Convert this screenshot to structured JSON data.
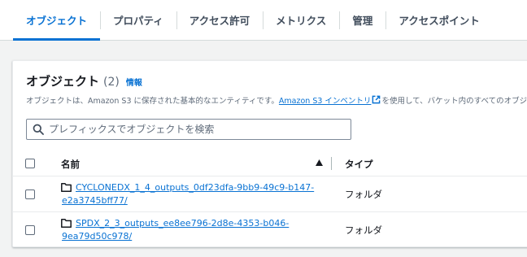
{
  "tabs": [
    {
      "label": "オブジェクト",
      "active": true
    },
    {
      "label": "プロパティ"
    },
    {
      "label": "アクセス許可"
    },
    {
      "label": "メトリクス"
    },
    {
      "label": "管理"
    },
    {
      "label": "アクセスポイント"
    }
  ],
  "objects_panel": {
    "title": "オブジェクト",
    "count": "(2)",
    "info_link": "情報",
    "description_prefix": "オブジェクトは、Amazon S3 に保存された基本的なエンティティです。",
    "description_link": "Amazon S3 インベントリ",
    "description_suffix": "を使用して、バケット内のすべてのオブジ",
    "search": {
      "placeholder": "プレフィックスでオブジェクトを検索",
      "value": ""
    }
  },
  "table": {
    "columns": {
      "name": "名前",
      "type": "タイプ"
    },
    "sort": "ascending",
    "rows": [
      {
        "name_line1": "CYCLONEDX_1_4_outputs_0df23dfa-9bb9-49c9-b147-",
        "name_line2": "e2a3745bff77/",
        "type": "フォルダ"
      },
      {
        "name_line1": "SPDX_2_3_outputs_ee8ee796-2d8e-4353-b046-",
        "name_line2": "9ea79d50c978/",
        "type": "フォルダ"
      }
    ]
  },
  "colors": {
    "accent": "#0972d3",
    "text": "#16191f",
    "muted": "#5f6b7a",
    "background": "#f2f3f3"
  }
}
